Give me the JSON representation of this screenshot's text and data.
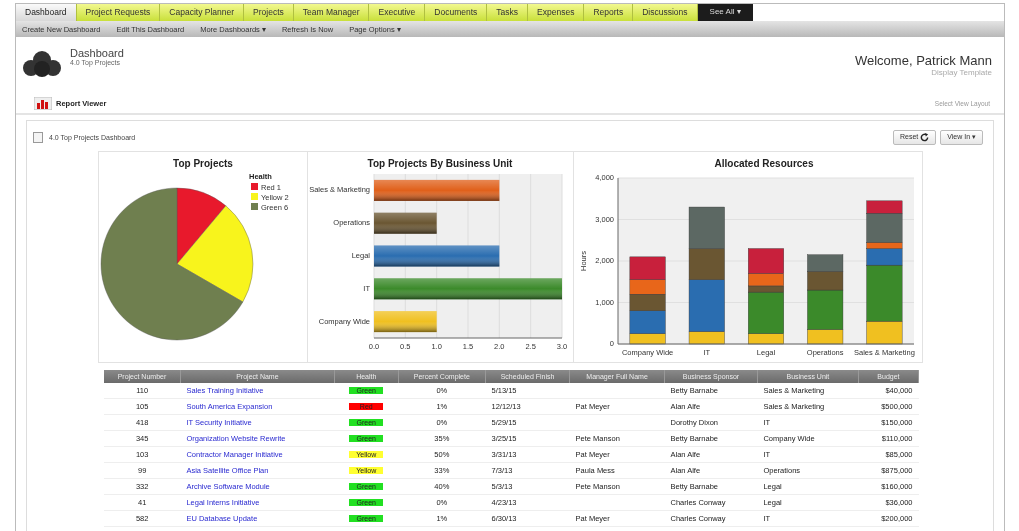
{
  "nav_tabs": [
    {
      "label": "Dashboard",
      "selected": true,
      "kind": "tab"
    },
    {
      "label": "Project Requests",
      "selected": false,
      "kind": "tab"
    },
    {
      "label": "Capacity Planner",
      "selected": false,
      "kind": "tab"
    },
    {
      "label": "Projects",
      "selected": false,
      "kind": "tab"
    },
    {
      "label": "Team Manager",
      "selected": false,
      "kind": "tab"
    },
    {
      "label": "Executive",
      "selected": false,
      "kind": "tab"
    },
    {
      "label": "Documents",
      "selected": false,
      "kind": "tab"
    },
    {
      "label": "Tasks",
      "selected": false,
      "kind": "tab"
    },
    {
      "label": "Expenses",
      "selected": false,
      "kind": "tab"
    },
    {
      "label": "Reports",
      "selected": false,
      "kind": "tab"
    },
    {
      "label": "Discussions",
      "selected": false,
      "kind": "tab"
    },
    {
      "label": "See All ▾",
      "selected": false,
      "kind": "menu"
    }
  ],
  "toolbar": [
    "Create New Dashboard",
    "Edit This Dashboard",
    "More Dashboards ▾",
    "Refresh Is Now",
    "Page Options ▾"
  ],
  "header": {
    "title": "Dashboard",
    "subtitle": "4.0 Top Projects",
    "welcome": "Welcome, Patrick Mann",
    "template": "Display Template"
  },
  "report_viewer": {
    "title": "Report Viewer",
    "layout_link": "Select View Layout"
  },
  "panel": {
    "title": "4.0 Top Projects Dashboard",
    "buttons": [
      "Reset",
      "View In ▾"
    ]
  },
  "charts": [
    {
      "chart_data": {
        "type": "pie",
        "title": "Top Projects",
        "legend": "top-right",
        "categories": [
          "Red 1",
          "Yellow 2",
          "Green 6"
        ],
        "colors": [
          "#e8192c",
          "#f8f41c",
          "#6f7f4f"
        ],
        "series": [
          {
            "name": "Health",
            "values": [
              1,
              2,
              6
            ]
          }
        ]
      }
    },
    {
      "chart_data": {
        "type": "bar",
        "orientation": "horizontal",
        "title": "Top Projects By Business Unit",
        "grid": true,
        "categories": [
          "Sales & Marketing",
          "Operations",
          "Legal",
          "IT",
          "Company Wide"
        ],
        "colors": [
          "#e0601a",
          "#6a5632",
          "#2a6db0",
          "#3b8a2a",
          "#f0c020"
        ],
        "series": [
          {
            "values": [
              2,
              1,
              2,
              3,
              1
            ]
          }
        ],
        "xlim": [
          0,
          3
        ],
        "xticks": [
          {
            "value": 0,
            "label": "0.0"
          },
          {
            "value": 0.5,
            "label": "0.5"
          },
          {
            "value": 1,
            "label": "1.0"
          },
          {
            "value": 1.5,
            "label": "1.5"
          },
          {
            "value": 2,
            "label": "2.0"
          },
          {
            "value": 2.5,
            "label": "2.5"
          },
          {
            "value": 3,
            "label": "3.0"
          }
        ]
      }
    },
    {
      "chart_data": {
        "type": "bar",
        "stacked": true,
        "title": "Allocated Resources",
        "grid": true,
        "ylabel": "Hours",
        "categories": [
          "Company Wide",
          "IT",
          "Legal",
          "Operations",
          "Sales & Marketing"
        ],
        "ylim": [
          0,
          4000
        ],
        "yticks": [
          {
            "value": 0,
            "label": "0"
          },
          {
            "value": 1000,
            "label": "1,000"
          },
          {
            "value": 2000,
            "label": "2,000"
          },
          {
            "value": 3000,
            "label": "3,000"
          },
          {
            "value": 4000,
            "label": "4,000"
          }
        ],
        "series": [
          {
            "color": "#f0c020",
            "values": [
              250,
              300,
              250,
              350,
              550
            ]
          },
          {
            "color": "#3b8a2a",
            "values": [
              0,
              0,
              1000,
              950,
              1350
            ]
          },
          {
            "color": "#2a6db0",
            "values": [
              550,
              1250,
              0,
              0,
              400
            ]
          },
          {
            "color": "#6a5632",
            "values": [
              400,
              750,
              150,
              450,
              0
            ]
          },
          {
            "color": "#e8661a",
            "values": [
              350,
              0,
              300,
              0,
              150
            ]
          },
          {
            "color": "#5c6863",
            "values": [
              0,
              1000,
              0,
              400,
              700
            ]
          },
          {
            "color": "#c8203c",
            "values": [
              550,
              0,
              600,
              0,
              300
            ]
          }
        ]
      }
    }
  ],
  "table": {
    "columns": [
      "Project Number",
      "Project Name",
      "Health",
      "Percent Complete",
      "Scheduled Finish",
      "Manager Full Name",
      "Business Sponsor",
      "Business Unit",
      "Budget"
    ],
    "rows": [
      {
        "number": "110",
        "name": "Sales Training Initiative",
        "health": {
          "label": "Green",
          "color": "#22e022"
        },
        "percent": "0%",
        "finish": "5/13/15",
        "sponsor": "Betty Barnabe",
        "unit": "Sales & Marketing",
        "budget": "$40,000"
      },
      {
        "number": "105",
        "name": "South America Expansion",
        "health": {
          "label": "Red",
          "color": "#ff0000"
        },
        "percent": "1%",
        "finish": "12/12/13",
        "manager": "Pat Meyer",
        "sponsor": "Alan Alfe",
        "unit": "Sales & Marketing",
        "budget": "$500,000"
      },
      {
        "number": "418",
        "name": "IT Security Initiative",
        "health": {
          "label": "Green",
          "color": "#22e022"
        },
        "percent": "0%",
        "finish": "5/29/15",
        "sponsor": "Dorothy Dixon",
        "unit": "IT",
        "budget": "$150,000"
      },
      {
        "number": "345",
        "name": "Organization Website Rewrite",
        "health": {
          "label": "Green",
          "color": "#22e022"
        },
        "percent": "35%",
        "finish": "3/25/15",
        "manager": "Pete Manson",
        "sponsor": "Betty Barnabe",
        "unit": "Company Wide",
        "budget": "$110,000"
      },
      {
        "number": "103",
        "name": "Contractor Manager Initiative",
        "health": {
          "label": "Yellow",
          "color": "#ffff30"
        },
        "percent": "50%",
        "finish": "3/31/13",
        "manager": "Pat Meyer",
        "sponsor": "Alan Alfe",
        "unit": "IT",
        "budget": "$85,000"
      },
      {
        "number": "99",
        "name": "Asia Satellite Office Plan",
        "health": {
          "label": "Yellow",
          "color": "#ffff30"
        },
        "percent": "33%",
        "finish": "7/3/13",
        "manager": "Paula Mess",
        "sponsor": "Alan Alfe",
        "unit": "Operations",
        "budget": "$875,000"
      },
      {
        "number": "332",
        "name": "Archive Software Module",
        "health": {
          "label": "Green",
          "color": "#22e022"
        },
        "percent": "40%",
        "finish": "5/3/13",
        "manager": "Pete Manson",
        "sponsor": "Betty Barnabe",
        "unit": "Legal",
        "budget": "$160,000"
      },
      {
        "number": "41",
        "name": "Legal Interns Initiative",
        "health": {
          "label": "Green",
          "color": "#22e022"
        },
        "percent": "0%",
        "finish": "4/23/13",
        "sponsor": "Charles Conway",
        "unit": "Legal",
        "budget": "$36,000"
      },
      {
        "number": "582",
        "name": "EU Database Update",
        "health": {
          "label": "Green",
          "color": "#22e022"
        },
        "percent": "1%",
        "finish": "6/30/13",
        "manager": "Pat Meyer",
        "sponsor": "Charles Conway",
        "unit": "IT",
        "budget": "$200,000"
      }
    ]
  }
}
